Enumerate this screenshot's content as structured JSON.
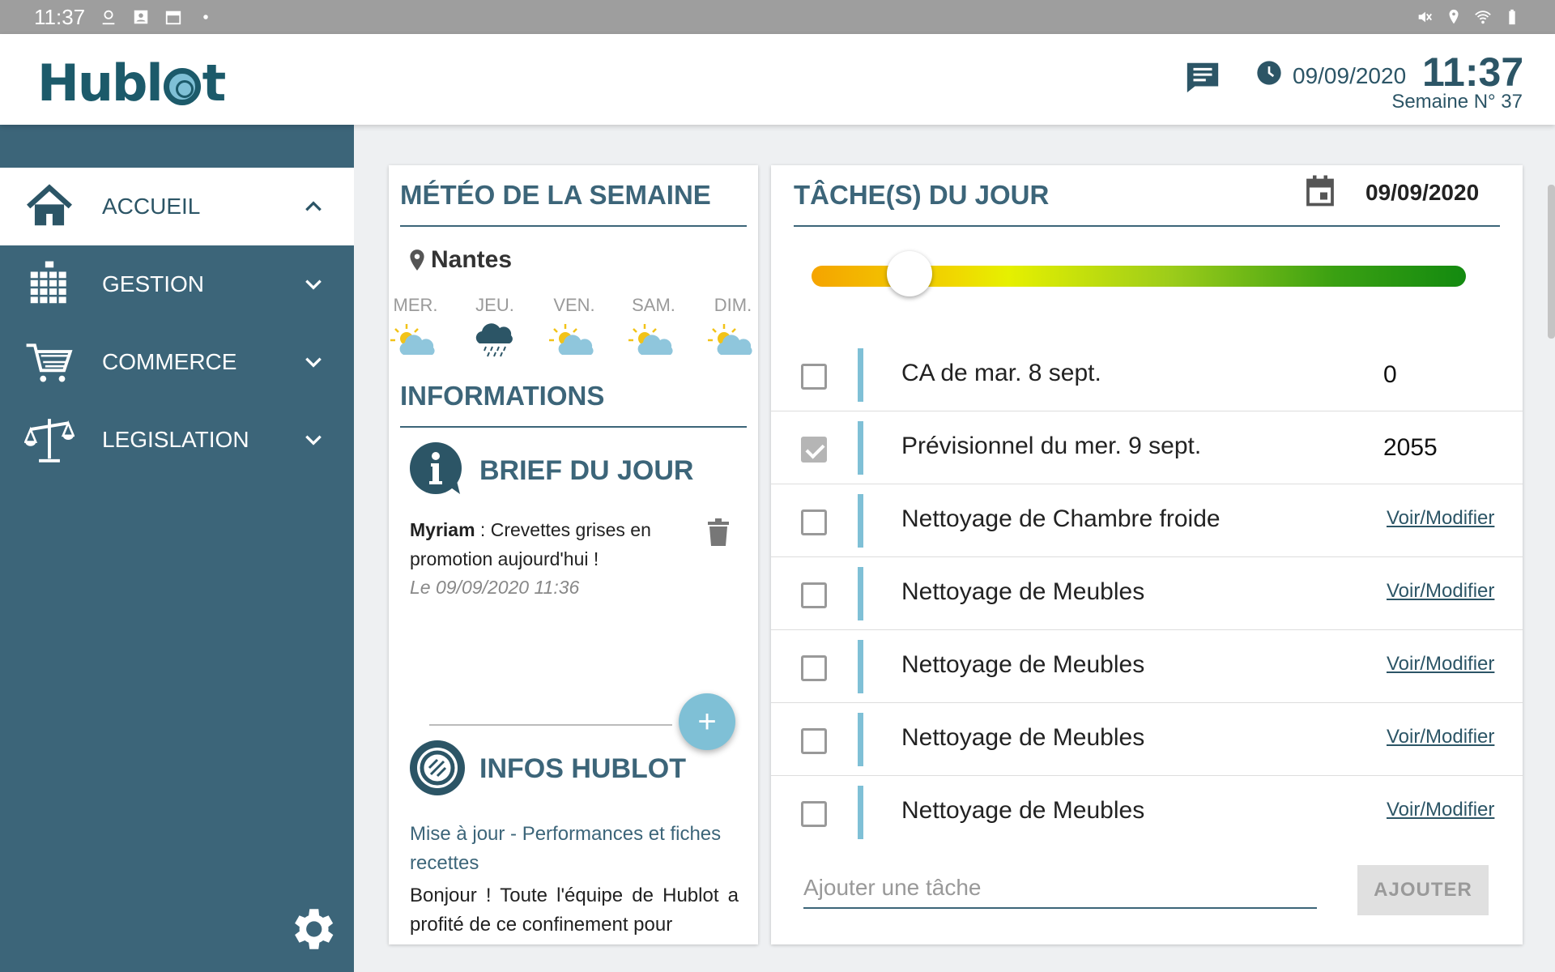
{
  "status_bar": {
    "time": "11:37"
  },
  "header": {
    "logo_pre": "Hubl",
    "logo_post": "t",
    "date": "09/09/2020",
    "time": "11:37",
    "week": "Semaine N° 37"
  },
  "sidebar": {
    "items": [
      {
        "label": "ACCUEIL",
        "icon": "house-icon",
        "active": true
      },
      {
        "label": "GESTION",
        "icon": "building-icon",
        "active": false
      },
      {
        "label": "COMMERCE",
        "icon": "cart-icon",
        "active": false
      },
      {
        "label": "LEGISLATION",
        "icon": "scales-icon",
        "active": false
      }
    ]
  },
  "weather": {
    "title": "MÉTÉO DE LA SEMAINE",
    "city": "Nantes",
    "days": [
      {
        "label": "MER.",
        "icon": "sun-cloud-icon"
      },
      {
        "label": "JEU.",
        "icon": "rain-cloud-icon"
      },
      {
        "label": "VEN.",
        "icon": "sun-cloud-icon"
      },
      {
        "label": "SAM.",
        "icon": "sun-cloud-icon"
      },
      {
        "label": "DIM.",
        "icon": "sun-cloud-icon"
      }
    ]
  },
  "informations": {
    "title": "INFORMATIONS",
    "brief": {
      "title": "BRIEF DU JOUR",
      "author": "Myriam",
      "message": " : Crevettes grises en promotion aujourd'hui !",
      "date": "Le 09/09/2020 11:36"
    },
    "add_label": "+",
    "hublot": {
      "title": "INFOS HUBLOT",
      "news_title": "Mise à jour - Performances et fiches recettes",
      "news_body": "Bonjour ! Toute l'équipe de Hublot a profité de ce confinement pour"
    }
  },
  "tasks": {
    "title": "TÂCHE(S) DU JOUR",
    "date": "09/09/2020",
    "progress": 0.15,
    "items": [
      {
        "label": "CA de mar. 8 sept.",
        "value": "0",
        "checked": false
      },
      {
        "label": "Prévisionnel du mer. 9 sept.",
        "value": "2055",
        "checked": true
      },
      {
        "label": "Nettoyage de Chambre froide",
        "link": "Voir/Modifier",
        "checked": false
      },
      {
        "label": "Nettoyage de Meubles",
        "link": "Voir/Modifier",
        "checked": false
      },
      {
        "label": "Nettoyage de Meubles",
        "link": "Voir/Modifier",
        "checked": false
      },
      {
        "label": "Nettoyage de Meubles",
        "link": "Voir/Modifier",
        "checked": false
      },
      {
        "label": "Nettoyage de Meubles",
        "link": "Voir/Modifier",
        "checked": false
      }
    ],
    "add_placeholder": "Ajouter une tâche",
    "add_button": "AJOUTER"
  },
  "colors": {
    "primary": "#3c6579",
    "accent": "#7fc0d6",
    "logo": "#1c5a6a"
  }
}
